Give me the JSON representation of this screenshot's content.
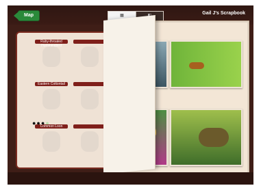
{
  "header": {
    "map_label": "Map",
    "title": "Gail J's Scrapbook",
    "segmented": [
      "",
      ""
    ]
  },
  "left_page": {
    "slot_labels": [
      "Ruby-throated Hummingbird",
      "",
      "Eastern Cottontail",
      "",
      "Common Loon",
      ""
    ],
    "pagination": "●●●"
  },
  "photos": {
    "top_left": "bird",
    "top_right": "frog",
    "bottom_left": "butterfly",
    "bottom_right": "turtle"
  }
}
